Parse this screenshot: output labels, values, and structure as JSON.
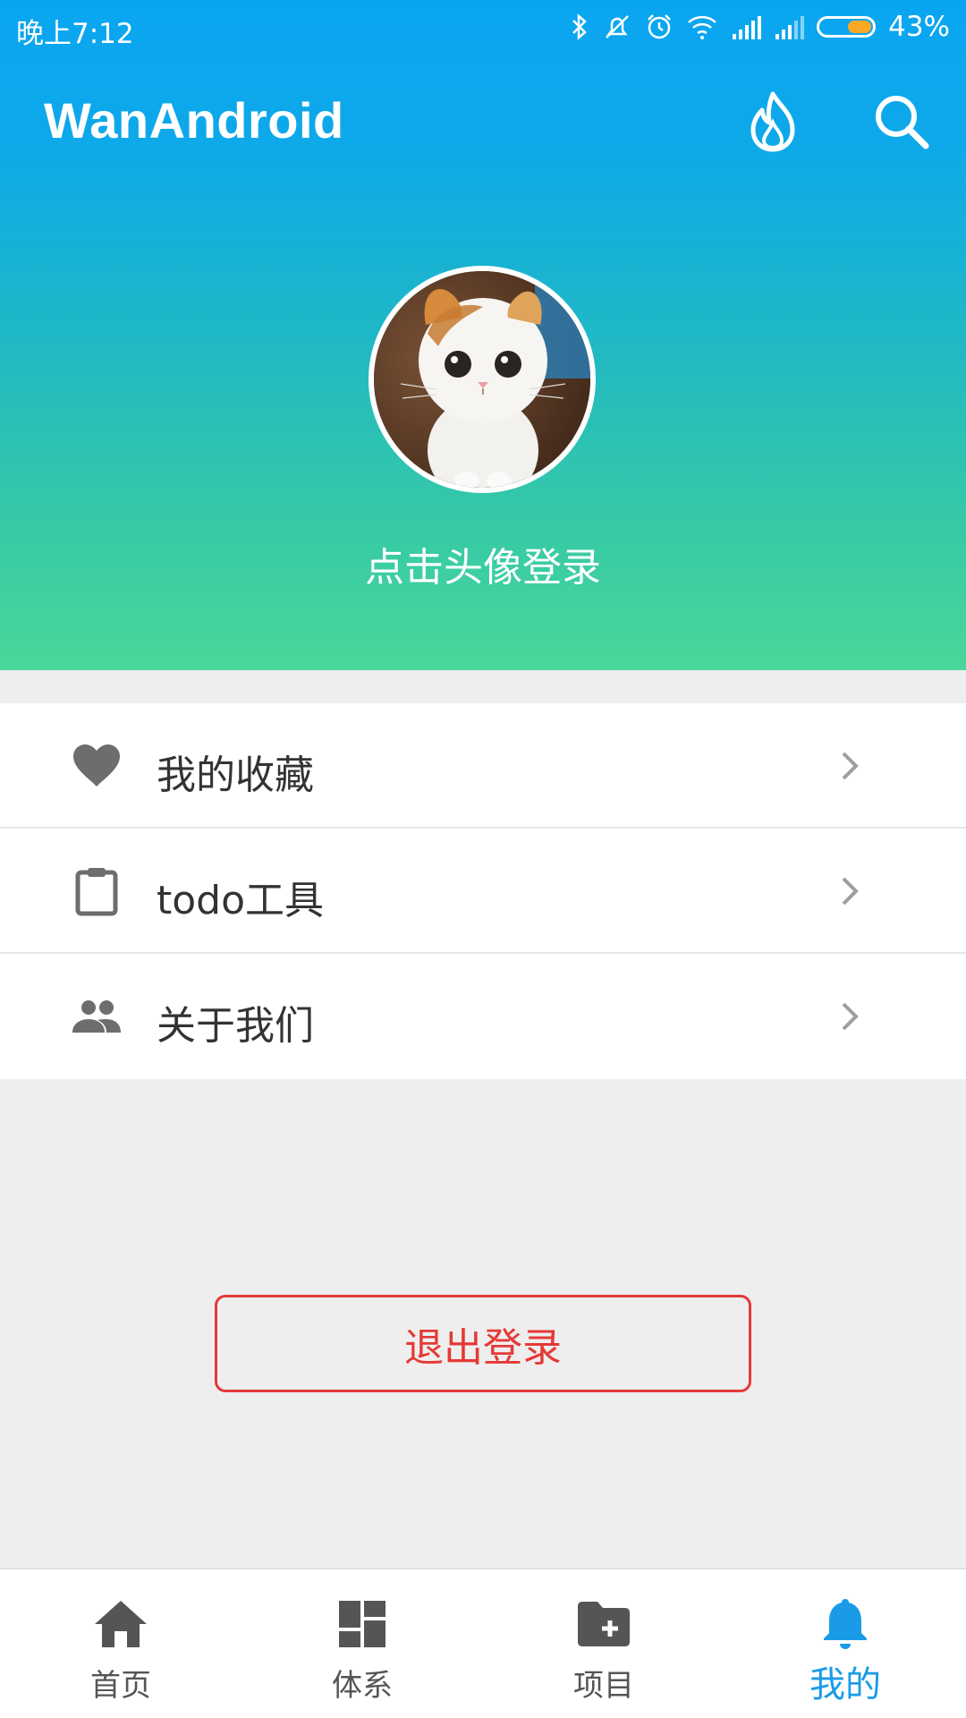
{
  "status_bar": {
    "time": "晚上7:12",
    "battery": "43%"
  },
  "toolbar": {
    "title": "WanAndroid",
    "icons": [
      "fire-icon",
      "search-icon"
    ]
  },
  "profile": {
    "login_hint": "点击头像登录"
  },
  "menu": {
    "items": [
      {
        "label": "我的收藏",
        "icon": "heart-icon"
      },
      {
        "label": "todo工具",
        "icon": "clipboard-icon"
      },
      {
        "label": "关于我们",
        "icon": "people-icon"
      }
    ]
  },
  "logout": {
    "label": "退出登录"
  },
  "bottom_nav": {
    "items": [
      {
        "label": "首页",
        "icon": "home-icon"
      },
      {
        "label": "体系",
        "icon": "dashboard-icon"
      },
      {
        "label": "项目",
        "icon": "folder-add-icon"
      },
      {
        "label": "我的",
        "icon": "bell-icon",
        "active": true
      }
    ]
  },
  "colors": {
    "accent": "#1a9be8",
    "gradient_top": "#0aa5f1",
    "gradient_bottom": "#4ad79a",
    "logout": "#e53935"
  }
}
